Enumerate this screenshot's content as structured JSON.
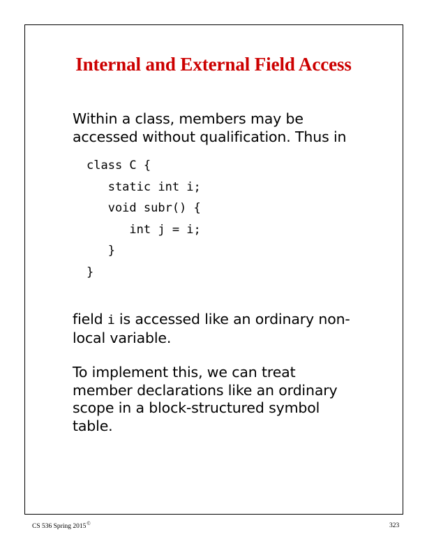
{
  "slide": {
    "title": "Internal and External Field Access",
    "title_color": "#CC0000",
    "paragraphs": {
      "intro": "Within a class, members may be accessed without qualification. Thus in",
      "field_prefix": "field ",
      "field_code": "i",
      "field_suffix": " is accessed like an ordinary non- local variable.",
      "implement": "To implement this, we can treat member declarations like an ordinary scope in a block-structured symbol table."
    },
    "code": {
      "line1": "class C {",
      "line2": "   static int i;",
      "line3": "   void subr() {",
      "line4": "      int j = i;",
      "line5": "   }",
      "line6": "}"
    }
  },
  "footer": {
    "credit": "CS 536  Spring 2015",
    "credit_mark": "©",
    "page_number": "323"
  }
}
